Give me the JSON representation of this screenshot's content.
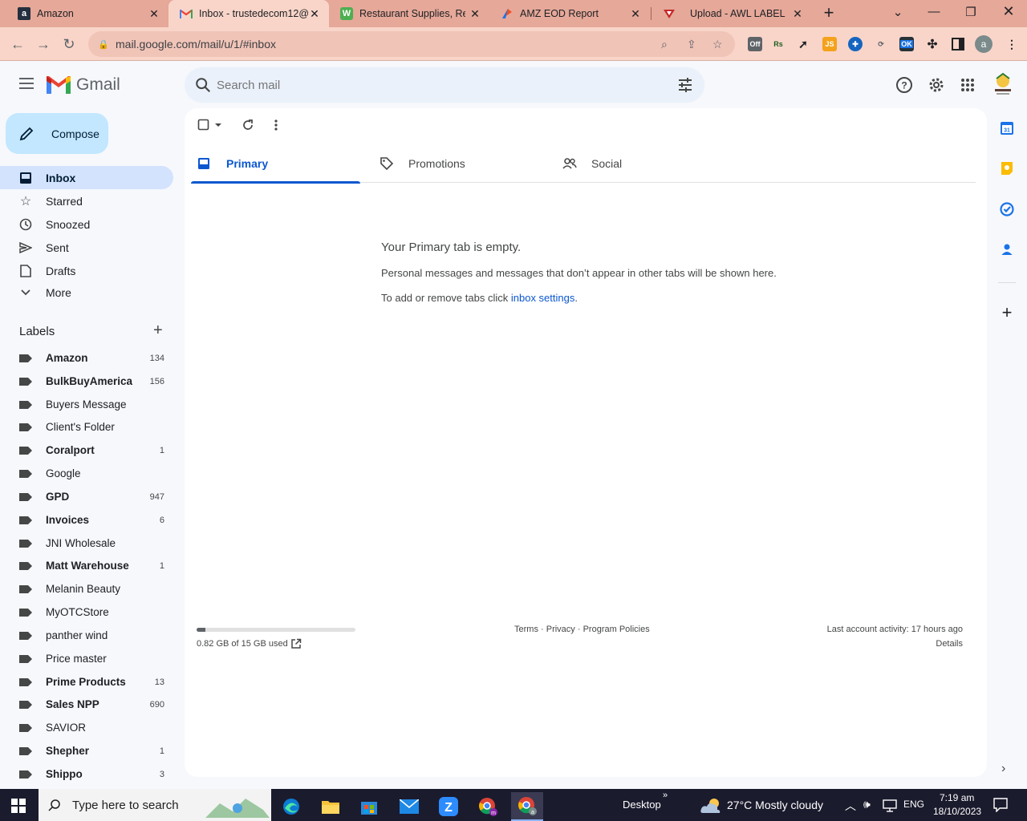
{
  "browser": {
    "tabs": [
      {
        "title": "Amazon",
        "favicon": "amazon-icon"
      },
      {
        "title": "Inbox - trustedecom12@",
        "favicon": "gmail-icon",
        "active": true
      },
      {
        "title": "Restaurant Supplies, Rest",
        "favicon": "webstaurant-icon"
      },
      {
        "title": "AMZ EOD Report",
        "favicon": "report-icon"
      },
      {
        "title": "Upload - AWL LABEL",
        "favicon": "awl-icon"
      }
    ],
    "url": "mail.google.com/mail/u/1/#inbox",
    "extensions": {
      "off_badge": "Off",
      "rs": "Rs",
      "js": "JS",
      "ok_badge": "OK"
    },
    "profile_initial": "a"
  },
  "gmail": {
    "brand": "Gmail",
    "search_placeholder": "Search mail",
    "compose_label": "Compose",
    "nav": [
      {
        "label": "Inbox",
        "icon": "inbox-icon",
        "active": true
      },
      {
        "label": "Starred",
        "icon": "star-icon"
      },
      {
        "label": "Snoozed",
        "icon": "clock-icon"
      },
      {
        "label": "Sent",
        "icon": "send-icon"
      },
      {
        "label": "Drafts",
        "icon": "draft-icon"
      },
      {
        "label": "More",
        "icon": "chevron-down-icon"
      }
    ],
    "labels_title": "Labels",
    "labels": [
      {
        "name": "Amazon",
        "count": "134",
        "bold": true
      },
      {
        "name": "BulkBuyAmerica",
        "count": "156",
        "bold": true
      },
      {
        "name": "Buyers Message",
        "count": "",
        "bold": false
      },
      {
        "name": "Client's Folder",
        "count": "",
        "bold": false
      },
      {
        "name": "Coralport",
        "count": "1",
        "bold": true
      },
      {
        "name": "Google",
        "count": "",
        "bold": false
      },
      {
        "name": "GPD",
        "count": "947",
        "bold": true
      },
      {
        "name": "Invoices",
        "count": "6",
        "bold": true
      },
      {
        "name": "JNI Wholesale",
        "count": "",
        "bold": false
      },
      {
        "name": "Matt Warehouse",
        "count": "1",
        "bold": true
      },
      {
        "name": "Melanin Beauty",
        "count": "",
        "bold": false
      },
      {
        "name": "MyOTCStore",
        "count": "",
        "bold": false
      },
      {
        "name": "panther wind",
        "count": "",
        "bold": false
      },
      {
        "name": "Price master",
        "count": "",
        "bold": false
      },
      {
        "name": "Prime Products",
        "count": "13",
        "bold": true
      },
      {
        "name": "Sales NPP",
        "count": "690",
        "bold": true
      },
      {
        "name": "SAVIOR",
        "count": "",
        "bold": false
      },
      {
        "name": "Shepher",
        "count": "1",
        "bold": true
      },
      {
        "name": "Shippo",
        "count": "3",
        "bold": true
      }
    ],
    "category_tabs": [
      {
        "label": "Primary",
        "icon": "inbox-icon",
        "active": true
      },
      {
        "label": "Promotions",
        "icon": "tag-icon"
      },
      {
        "label": "Social",
        "icon": "people-icon"
      }
    ],
    "empty": {
      "title": "Your Primary tab is empty.",
      "description": "Personal messages and messages that don’t appear in other tabs will be shown here.",
      "hint_prefix": "To add or remove tabs click ",
      "hint_link": "inbox settings",
      "hint_suffix": "."
    },
    "storage": {
      "text": "0.82 GB of 15 GB used",
      "fraction": 0.055
    },
    "footer": {
      "terms": "Terms",
      "privacy": "Privacy",
      "policies": "Program Policies",
      "sep": " · "
    },
    "activity": {
      "text": "Last account activity: 17 hours ago",
      "details": "Details"
    }
  },
  "taskbar": {
    "search_placeholder": "Type here to search",
    "desktop_label": "Desktop",
    "weather": "27°C  Mostly cloudy",
    "language": "ENG",
    "time": "7:19 am",
    "date": "18/10/2023"
  },
  "colors": {
    "gmail_blue": "#0b57d0",
    "compose_bg": "#c2e7ff",
    "active_nav": "#d3e3fd",
    "tab_strip": "#e5a899"
  }
}
